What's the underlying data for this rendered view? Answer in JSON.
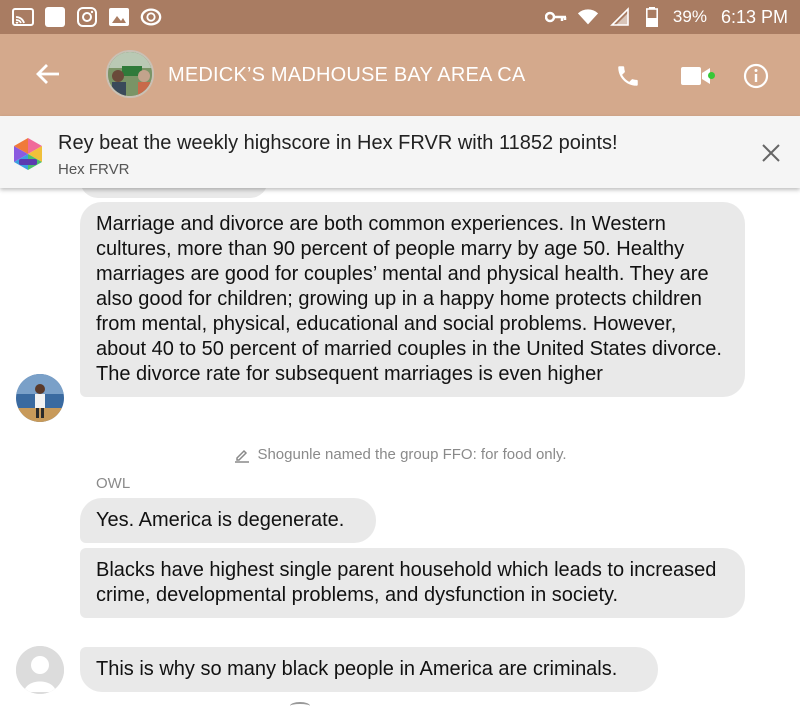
{
  "status_bar": {
    "battery": "39%",
    "time": "6:13 PM"
  },
  "header": {
    "title": "MEDICK’S MADHOUSE BAY AREA CA",
    "icons": [
      "back-arrow-icon",
      "phone-icon",
      "video-camera-icon",
      "info-icon"
    ],
    "active_dot_color": "#37c837",
    "bar_color": "#d4a98c"
  },
  "notification": {
    "title": "Rey beat the weekly highscore in Hex FRVR with 11852 points!",
    "subtitle": "Hex FRVR"
  },
  "messages": [
    {
      "text": "Marriage and divorce are both common experiences. In Western cultures, more than 90 percent of people marry by age 50. Healthy marriages are good for couples’ mental and physical health. They are also good for children; growing up in a happy home protects children from mental, physical, educational and social problems. However, about 40 to 50 percent of married couples in the United States divorce. The divorce rate for subsequent marriages is even higher"
    },
    {
      "text": "Yes.  America is degenerate."
    },
    {
      "text": "Blacks have highest single parent household which leads to increased crime, developmental problems, and dysfunction in society."
    },
    {
      "text": "This is why so many black people in America are criminals."
    }
  ],
  "system_message": "Shogunle named the group FFO: for food only.",
  "sender_name": "OWL"
}
